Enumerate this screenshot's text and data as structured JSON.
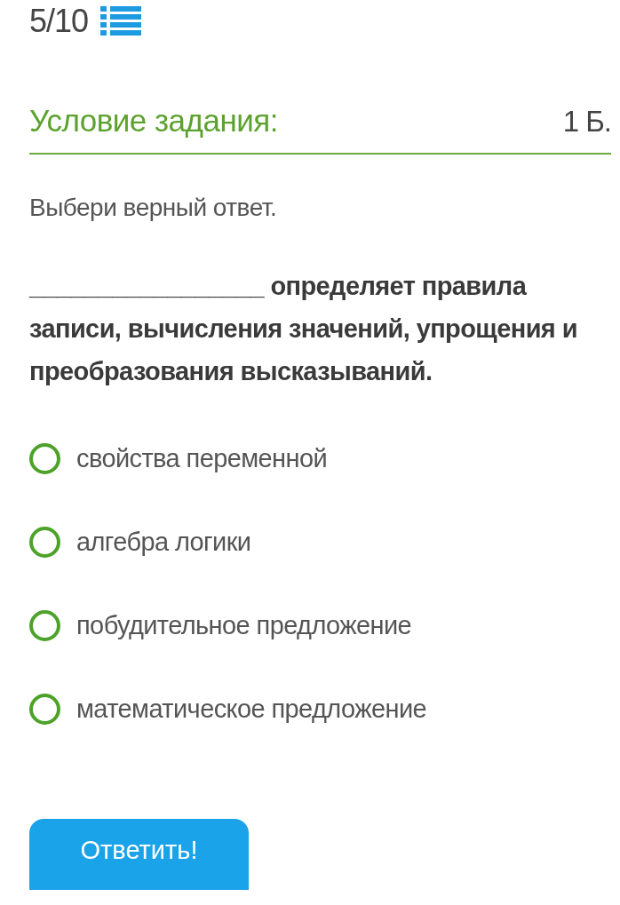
{
  "progress": {
    "counter": "5/10"
  },
  "task": {
    "heading": "Условие задания:",
    "points": "1 Б."
  },
  "instruction": "Выбери верный ответ.",
  "question": "_________________ определяет правила записи, вычисления значений, упрощения и преобразования высказываний.",
  "options": [
    {
      "label": "свойства переменной",
      "selected": false
    },
    {
      "label": "алгебра логики",
      "selected": false
    },
    {
      "label": "побудительное предложение",
      "selected": false
    },
    {
      "label": "математическое предложение",
      "selected": false
    }
  ],
  "submit_button": "Ответить!"
}
